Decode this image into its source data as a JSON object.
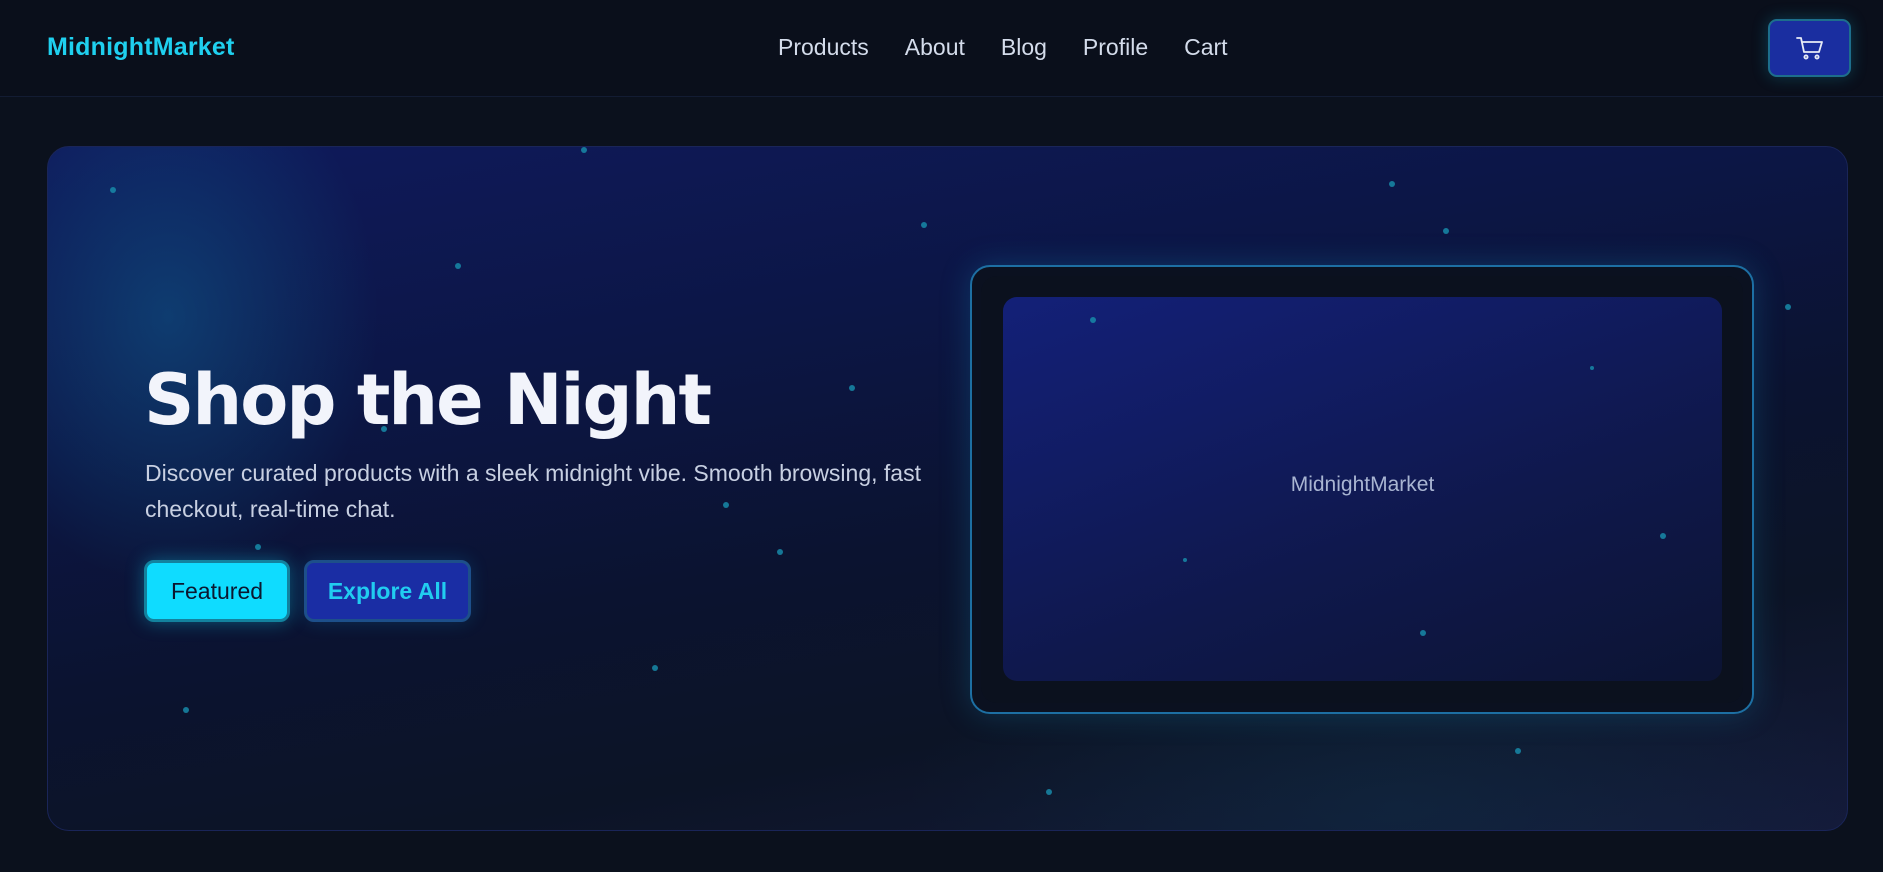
{
  "navbar": {
    "brand": "MidnightMarket",
    "links": [
      "Products",
      "About",
      "Blog",
      "Profile",
      "Cart"
    ],
    "cart_icon": "shopping-cart-icon"
  },
  "hero": {
    "title": "Shop the Night",
    "subtitle": "Discover curated products with a sleek midnight vibe. Smooth browsing, fast checkout, real-time chat.",
    "featured_label": "Featured",
    "explore_label": "Explore All",
    "device_label": "MidnightMarket"
  },
  "colors": {
    "background": "#0b111d",
    "brand": "#1fd0ef",
    "accent_cyan": "#0fdcff",
    "accent_blue": "#1a2da4"
  }
}
